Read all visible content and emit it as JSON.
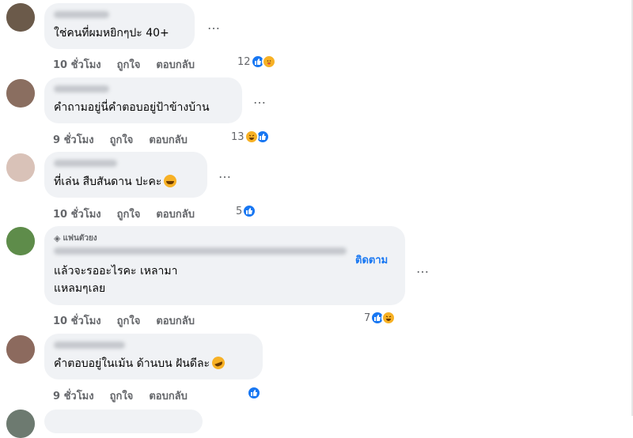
{
  "comments": [
    {
      "text": "ใช่คนที่ผมหยิกๆปะ 40+",
      "time": "10 ชั่วโมง",
      "like": "ถูกใจ",
      "reply": "ตอบกลับ",
      "count": "12",
      "reactions": [
        "like-icon",
        "care-icon"
      ]
    },
    {
      "text": "คำถามอยู่นี่คำตอบอยู่ป้าข้างบ้าน",
      "time": "9 ชั่วโมง",
      "like": "ถูกใจ",
      "reply": "ตอบกลับ",
      "count": "13",
      "reactions": [
        "haha-icon",
        "like-icon"
      ]
    },
    {
      "text": "ที่เล่น สืบสันดาน ปะคะ",
      "time": "10 ชั่วโมง",
      "like": "ถูกใจ",
      "reply": "ตอบกลับ",
      "count": "5",
      "reactions": [
        "like-icon"
      ],
      "inline_emoji": "grinning-emoji-icon"
    },
    {
      "badge": "แฟนตัวยง",
      "follow": "ติดตาม",
      "text": "แล้วจะรออะไรคะ เหลามา\nแหลมๆเลย",
      "time": "10 ชั่วโมง",
      "like": "ถูกใจ",
      "reply": "ตอบกลับ",
      "count": "7",
      "reactions": [
        "like-icon",
        "haha-icon"
      ]
    },
    {
      "text": "คำตอบอยู่ในเม้น ด้านบน ฝันดีละ",
      "time": "9 ชั่วโมง",
      "like": "ถูกใจ",
      "reply": "ตอบกลับ",
      "count": "",
      "reactions": [
        "like-icon"
      ],
      "inline_emoji": "rofl-emoji-icon"
    }
  ],
  "more_icon": "…"
}
